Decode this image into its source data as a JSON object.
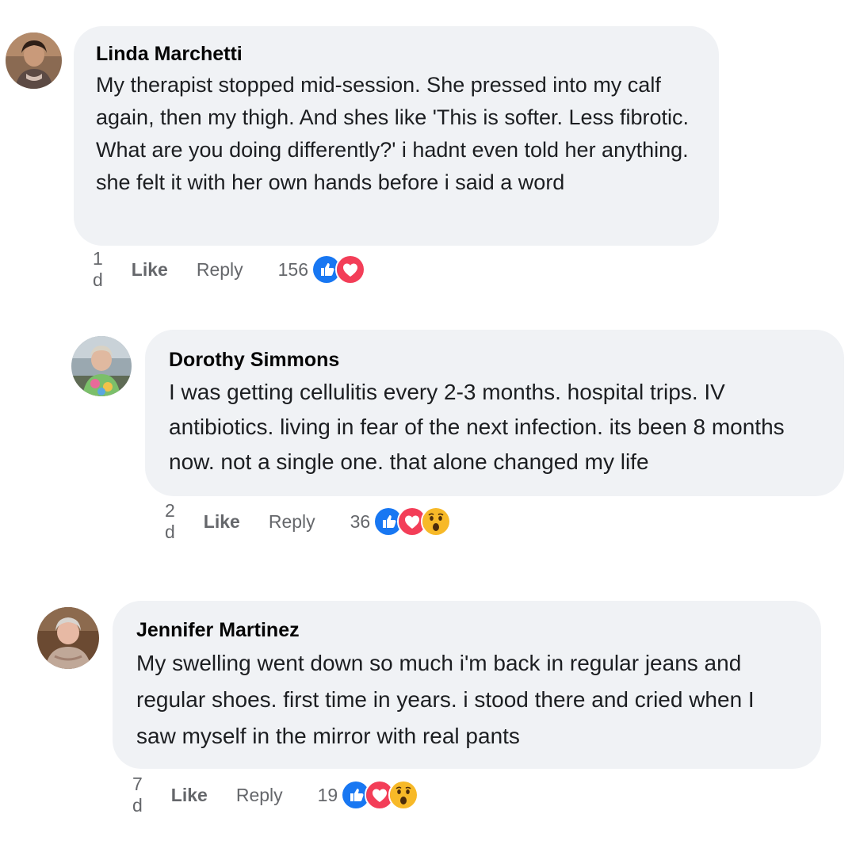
{
  "comments": [
    {
      "author": "Linda Marchetti",
      "text": "My therapist stopped mid-session. She pressed into my calf again, then my thigh. And shes like 'This is softer. Less fibrotic. What are you doing differently?' i hadnt even told her anything. she felt it with her own hands before i said a word",
      "time": "1 d",
      "like_label": "Like",
      "reply_label": "Reply",
      "reaction_count": "156",
      "reactions": [
        "like-icon",
        "love-icon"
      ]
    },
    {
      "author": "Dorothy Simmons",
      "text": "I was getting cellulitis every 2-3 months. hospital trips. IV antibiotics. living in fear of the next infection. its been 8 months now. not a single one. that alone changed my life",
      "time": "2 d",
      "like_label": "Like",
      "reply_label": "Reply",
      "reaction_count": "36",
      "reactions": [
        "like-icon",
        "love-icon",
        "wow-icon"
      ]
    },
    {
      "author": "Jennifer Martinez",
      "text": "My swelling went down so much i'm back in regular jeans and regular shoes. first time in years. i stood there and cried when I saw myself in the mirror with real pants",
      "time": "7 d",
      "like_label": "Like",
      "reply_label": "Reply",
      "reaction_count": "19",
      "reactions": [
        "like-icon",
        "love-icon",
        "wow-icon"
      ]
    }
  ],
  "colors": {
    "bubble": "#f0f2f5",
    "meta_text": "#65676b",
    "like_blue": "#1877f2",
    "love_red": "#f33e58",
    "wow_yellow": "#f7b928"
  }
}
